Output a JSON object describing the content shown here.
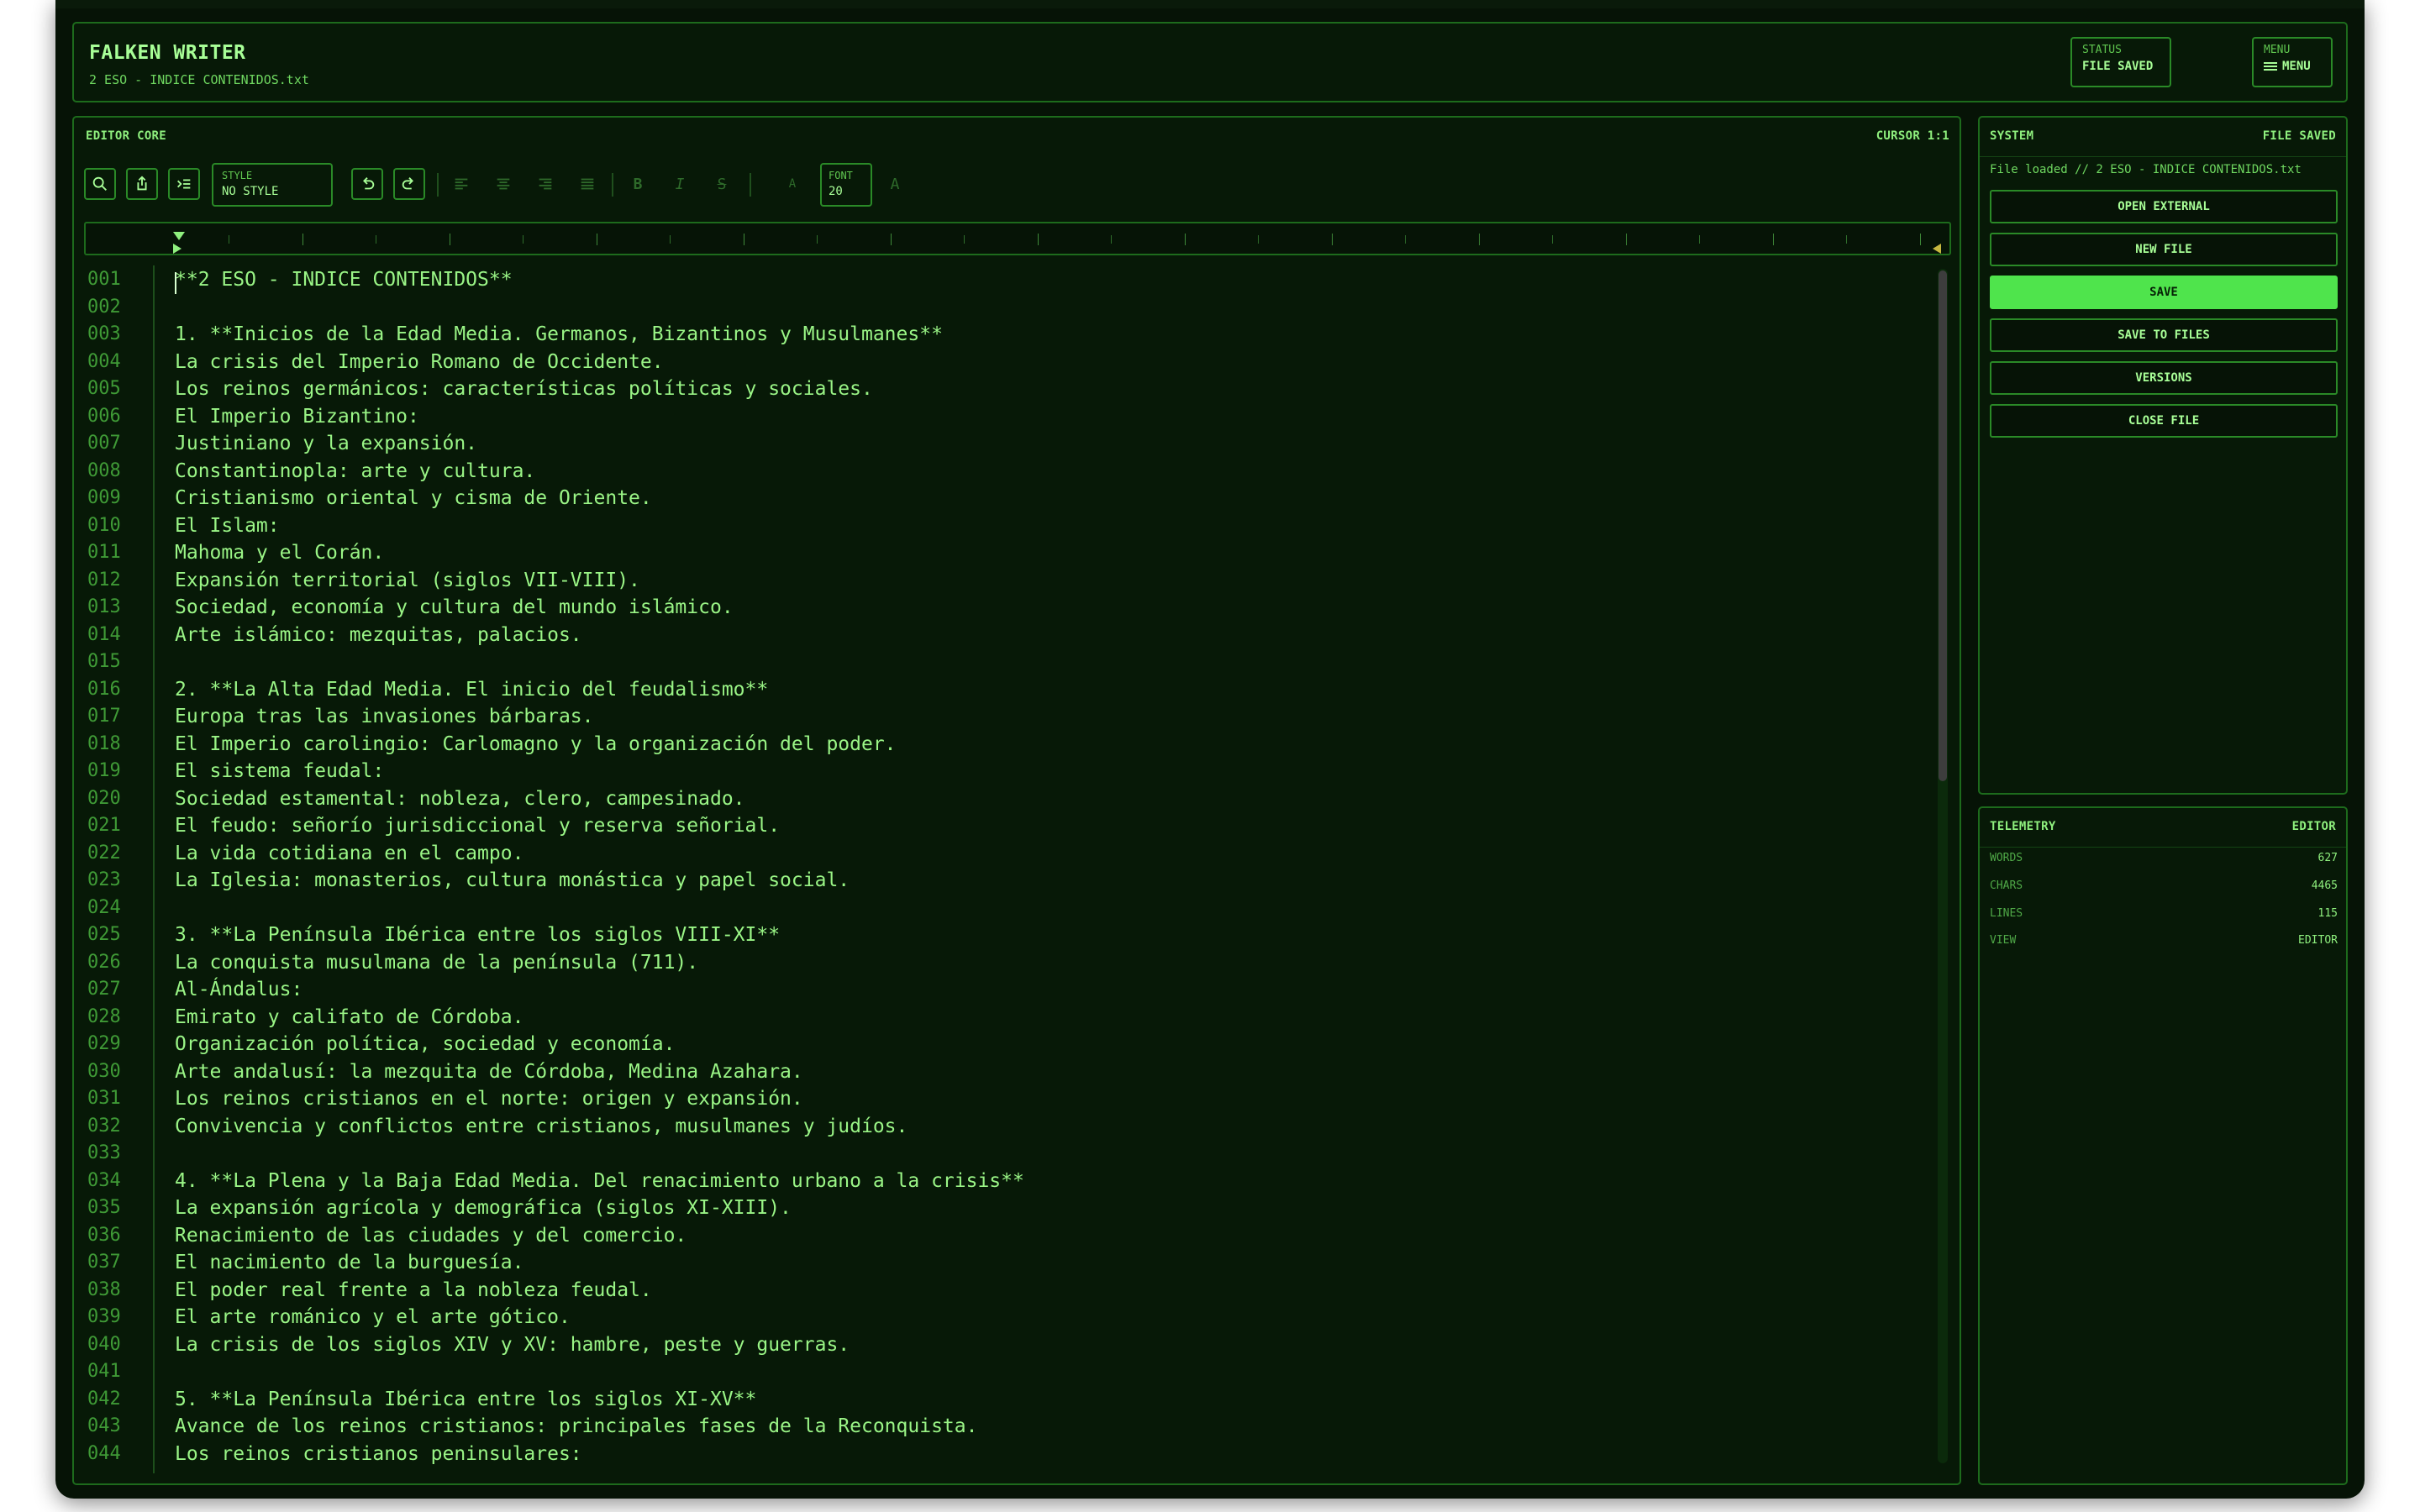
{
  "header": {
    "app_title": "FALKEN WRITER",
    "file_name": "2 ESO - INDICE CONTENIDOS.txt",
    "status_key": "STATUS",
    "status_value": "FILE SAVED",
    "menu_key": "MENU",
    "menu_value": "MENU"
  },
  "editor": {
    "title": "EDITOR CORE",
    "cursor": "CURSOR 1:1",
    "toolbar": {
      "icons": [
        "search-icon",
        "export-icon",
        "insert-icon",
        "undo-icon",
        "redo-icon",
        "align-left-icon",
        "align-center-icon",
        "align-right-icon",
        "align-justify-icon",
        "bold-icon",
        "italic-icon",
        "strikethrough-icon",
        "decrease-font-icon",
        "increase-font-icon"
      ],
      "style_key": "STYLE",
      "style_value": "NO STYLE",
      "bold": "B",
      "italic": "I",
      "strike": "S",
      "font_small": "A",
      "font_key": "FONT",
      "font_value": "20",
      "font_large": "A"
    },
    "lines": [
      {
        "no": "001",
        "text": "**2 ESO - INDICE CONTENIDOS**"
      },
      {
        "no": "002",
        "text": ""
      },
      {
        "no": "003",
        "text": "1. **Inicios de la Edad Media. Germanos, Bizantinos y Musulmanes**"
      },
      {
        "no": "004",
        "text": "La crisis del Imperio Romano de Occidente."
      },
      {
        "no": "005",
        "text": "Los reinos germánicos: características políticas y sociales."
      },
      {
        "no": "006",
        "text": "El Imperio Bizantino:"
      },
      {
        "no": "007",
        "text": "Justiniano y la expansión."
      },
      {
        "no": "008",
        "text": "Constantinopla: arte y cultura."
      },
      {
        "no": "009",
        "text": "Cristianismo oriental y cisma de Oriente."
      },
      {
        "no": "010",
        "text": "El Islam:"
      },
      {
        "no": "011",
        "text": "Mahoma y el Corán."
      },
      {
        "no": "012",
        "text": "Expansión territorial (siglos VII-VIII)."
      },
      {
        "no": "013",
        "text": "Sociedad, economía y cultura del mundo islámico."
      },
      {
        "no": "014",
        "text": "Arte islámico: mezquitas, palacios."
      },
      {
        "no": "015",
        "text": ""
      },
      {
        "no": "016",
        "text": "2. **La Alta Edad Media. El inicio del feudalismo**"
      },
      {
        "no": "017",
        "text": "Europa tras las invasiones bárbaras."
      },
      {
        "no": "018",
        "text": "El Imperio carolingio: Carlomagno y la organización del poder."
      },
      {
        "no": "019",
        "text": "El sistema feudal:"
      },
      {
        "no": "020",
        "text": "Sociedad estamental: nobleza, clero, campesinado."
      },
      {
        "no": "021",
        "text": "El feudo: señorío jurisdiccional y reserva señorial."
      },
      {
        "no": "022",
        "text": "La vida cotidiana en el campo."
      },
      {
        "no": "023",
        "text": "La Iglesia: monasterios, cultura monástica y papel social."
      },
      {
        "no": "024",
        "text": ""
      },
      {
        "no": "025",
        "text": "3. **La Península Ibérica entre los siglos VIII-XI**"
      },
      {
        "no": "026",
        "text": "La conquista musulmana de la península (711)."
      },
      {
        "no": "027",
        "text": "Al-Ándalus:"
      },
      {
        "no": "028",
        "text": "Emirato y califato de Córdoba."
      },
      {
        "no": "029",
        "text": "Organización política, sociedad y economía."
      },
      {
        "no": "030",
        "text": "Arte andalusí: la mezquita de Córdoba, Medina Azahara."
      },
      {
        "no": "031",
        "text": "Los reinos cristianos en el norte: origen y expansión."
      },
      {
        "no": "032",
        "text": "Convivencia y conflictos entre cristianos, musulmanes y judíos."
      },
      {
        "no": "033",
        "text": ""
      },
      {
        "no": "034",
        "text": "4. **La Plena y la Baja Edad Media. Del renacimiento urbano a la crisis**"
      },
      {
        "no": "035",
        "text": "La expansión agrícola y demográfica (siglos XI-XIII)."
      },
      {
        "no": "036",
        "text": "Renacimiento de las ciudades y del comercio."
      },
      {
        "no": "037",
        "text": "El nacimiento de la burguesía."
      },
      {
        "no": "038",
        "text": "El poder real frente a la nobleza feudal."
      },
      {
        "no": "039",
        "text": "El arte románico y el arte gótico."
      },
      {
        "no": "040",
        "text": "La crisis de los siglos XIV y XV: hambre, peste y guerras."
      },
      {
        "no": "041",
        "text": ""
      },
      {
        "no": "042",
        "text": "5. **La Península Ibérica entre los siglos XI-XV**"
      },
      {
        "no": "043",
        "text": "Avance de los reinos cristianos: principales fases de la Reconquista."
      },
      {
        "no": "044",
        "text": "Los reinos cristianos peninsulares:"
      }
    ]
  },
  "system": {
    "title": "SYSTEM",
    "status": "FILE SAVED",
    "message": "File loaded // 2 ESO - INDICE CONTENIDOS.txt",
    "buttons": [
      "OPEN EXTERNAL",
      "NEW FILE",
      "SAVE",
      "SAVE TO FILES",
      "VERSIONS",
      "CLOSE FILE"
    ]
  },
  "telemetry": {
    "title": "TELEMETRY",
    "mode": "EDITOR",
    "rows": [
      {
        "key": "WORDS",
        "value": "627"
      },
      {
        "key": "CHARS",
        "value": "4465"
      },
      {
        "key": "LINES",
        "value": "115"
      },
      {
        "key": "VIEW",
        "value": "EDITOR"
      }
    ]
  },
  "colors": {
    "background": "#061306",
    "text": "#9af586",
    "accent": "#4fe44c",
    "border": "#2a8a27"
  }
}
